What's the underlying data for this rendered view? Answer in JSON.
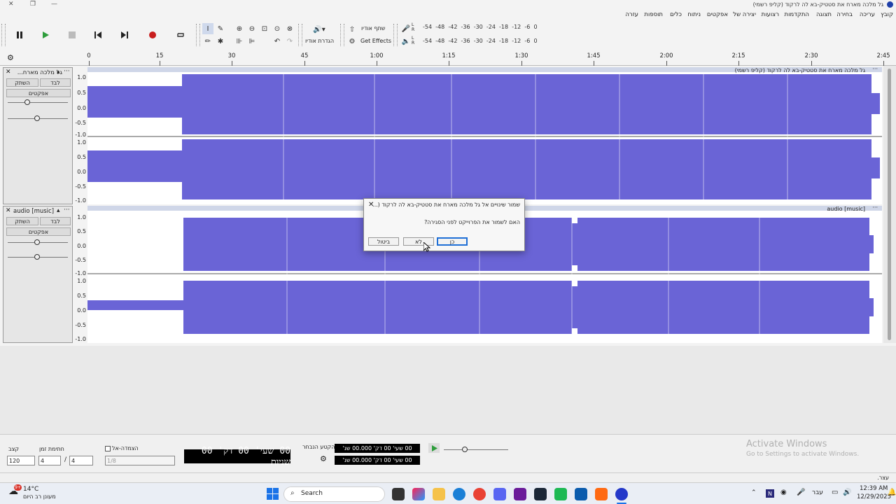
{
  "window": {
    "title": "גל מלכה מארח את סטטיק-בא לה לרקוד (קליפ רשמי)"
  },
  "menu": [
    "קובץ",
    "עריכה",
    "בחירה",
    "תצוגה",
    "התקדמות",
    "רצועות",
    "יצירה של",
    "אפקטים",
    "ניתוח",
    "כלים",
    "תוספות",
    "עזרה"
  ],
  "toolbar": {
    "share_label": "שתף אודיו",
    "audio_setup_label": "הגדרת אודיו",
    "get_effects_label": "Get Effects",
    "meter_scale": [
      "-54",
      "-48",
      "-42",
      "-36",
      "-30",
      "-24",
      "-18",
      "-12",
      "-6",
      "0"
    ]
  },
  "ruler": {
    "ticks": [
      "0",
      "15",
      "30",
      "45",
      "1:00",
      "1:15",
      "1:30",
      "1:45",
      "2:00",
      "2:15",
      "2:30",
      "2:45"
    ]
  },
  "tracks": [
    {
      "name": "גל מלכה מארח...",
      "clip_title": "גל מלכה מארח את סטטיק-בא לה לרקוד (קליפ רשמי)",
      "mute": "השתק",
      "solo": "לבד",
      "effects": "אפקטים"
    },
    {
      "name": "audio [music]",
      "clip_title": "audio [music]",
      "mute": "השתק",
      "solo": "לבד",
      "effects": "אפקטים"
    }
  ],
  "scale_labels": [
    "1.0",
    "0.5",
    "0.0",
    "-0.5",
    "-1.0"
  ],
  "dialog": {
    "title": "שמור שינויים אל גל מלכה מארח את סטטיק-בא לה לרקוד (...",
    "message": "האם לשמור את הפרוייקט לפני הסגירה?",
    "yes": "כן",
    "no": "לא",
    "cancel": "ביטול"
  },
  "bottom": {
    "tempo_label": "קצב",
    "tempo_value": "120",
    "timesig_label": "חתימת זמן",
    "timesig_num": "4",
    "timesig_den": "4",
    "snap_label": "הצמדה-אל",
    "snap_value": "1/8",
    "time_display": "00 שעי' 00 דק' 00 שניות",
    "selection_label": "הקטע הנבחר",
    "sel_start": "00 שעי' 00 דק' 00.000 שנ'",
    "sel_end": "00 שעי' 00 דק' 00.000 שנ'"
  },
  "activate": {
    "line1": "Activate Windows",
    "line2": "Go to Settings to activate Windows."
  },
  "status": {
    "text": "עצר."
  },
  "taskbar": {
    "weather_temp": "14°C",
    "weather_desc": "מעונן רב היום",
    "search": "Search",
    "lang": "עבר",
    "time": "12:39 AM",
    "date": "12/29/2025",
    "badge": "9+"
  },
  "colors": {
    "wave": "#6a64d6",
    "selected_bg": "#ffffff",
    "dialog_primary": "#1f6fd6"
  }
}
